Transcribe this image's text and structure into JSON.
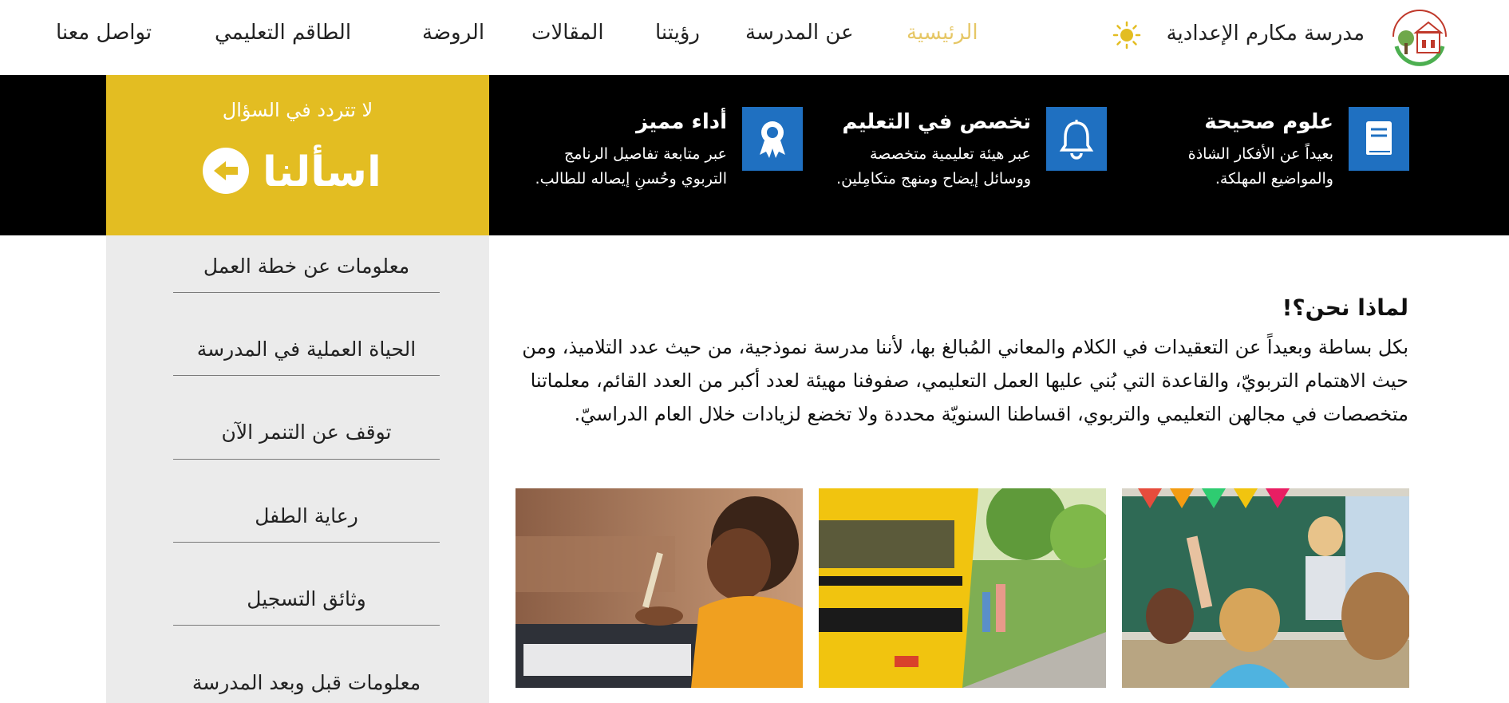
{
  "header": {
    "school_name": "مدرسة مكارم الإعدادية",
    "nav": [
      "الرئيسية",
      "عن المدرسة",
      "رؤيتنا",
      "المقالات",
      "الروضة",
      "الطاقم التعليمي",
      "تواصل معنا"
    ],
    "active_color": "#e6c766"
  },
  "features": [
    {
      "title": "علوم صحيحة",
      "text": "بعيداً عن الأفكار الشاذة والمواضيع المهلكة.",
      "icon": "book-icon"
    },
    {
      "title": "تخصص في التعليم",
      "text": "عبر هيئة تعليمية متخصصة ووسائل إيضاح ومنهج متكامِلين.",
      "icon": "bell-icon"
    },
    {
      "title": "أداء مميز",
      "text": "عبر متابعة تفاصيل الرنامج التربوي وحُسنِ إيصاله للطالب.",
      "icon": "award-ribbon-icon"
    }
  ],
  "ask": {
    "subtitle": "لا تتردد في السؤال",
    "title": "اسألنا"
  },
  "sidebar": {
    "items": [
      "معلومات عن خطة العمل",
      "الحياة العملية في المدرسة",
      "توقف عن التنمر الآن",
      "رعاية الطفل",
      "وثائق التسجيل",
      "معلومات قبل وبعد المدرسة"
    ]
  },
  "why": {
    "title": "لماذا نحن؟!",
    "text": "بكل بساطة وبعيداً عن التعقيدات في الكلام والمعاني المُبالغ بها، لأننا مدرسة نموذجية، من حيث عدد التلاميذ، ومن حيث الاهتمام التربويّ، والقاعدة التي بُني عليها العمل التعليمي، صفوفنا مهيئة لعدد أكبر من العدد القائم، معلماتنا متخصصات في مجالهن التعليمي والتربوي، اقساطنا السنويّة محددة ولا تخضع لزيادات خلال العام الدراسيّ."
  },
  "colors": {
    "accent_yellow": "#e3bd22",
    "icon_blue": "#1f70c1",
    "bar_black": "#000000",
    "sidebar_gray": "#ebebeb"
  }
}
